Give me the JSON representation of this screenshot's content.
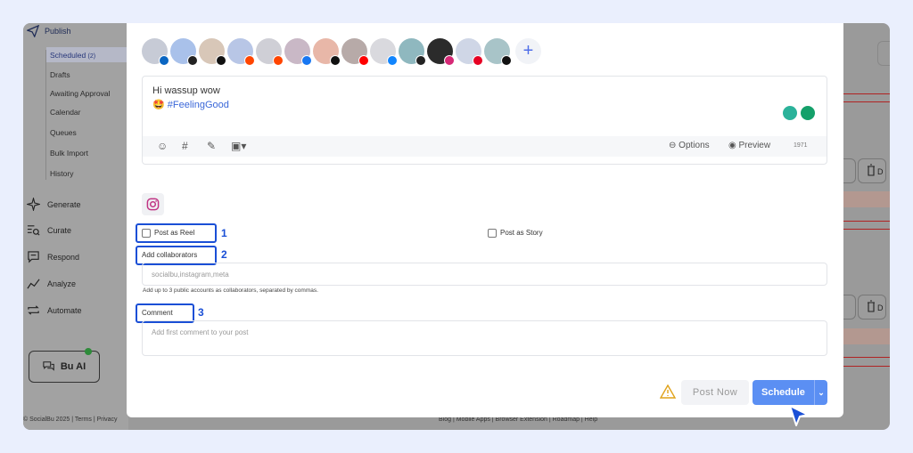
{
  "sidebar": {
    "publish": "Publish",
    "sub_items": [
      {
        "label": "Scheduled",
        "count": "(2)"
      },
      {
        "label": "Drafts"
      },
      {
        "label": "Awaiting Approval"
      },
      {
        "label": "Calendar"
      },
      {
        "label": "Queues"
      },
      {
        "label": "Bulk Import"
      },
      {
        "label": "History"
      }
    ],
    "nav": [
      "Generate",
      "Curate",
      "Respond",
      "Analyze",
      "Automate"
    ],
    "ai_button": "Bu AI",
    "footer": "© SocialBu 2025 | Terms | Privacy"
  },
  "page_footer": "Blog | Mobile Apps | Browser Extension | Roadmap | Help",
  "composer": {
    "accounts": [
      {
        "badge": "linkedin",
        "color": "#0a66c2"
      },
      {
        "badge": "threads",
        "color": "#222"
      },
      {
        "badge": "x",
        "color": "#111"
      },
      {
        "badge": "reddit",
        "color": "#ff4500"
      },
      {
        "badge": "reddit",
        "color": "#ff4500"
      },
      {
        "badge": "facebook",
        "color": "#1877f2"
      },
      {
        "badge": "tiktok",
        "color": "#111"
      },
      {
        "badge": "youtube",
        "color": "#ff0000"
      },
      {
        "badge": "bluesky",
        "color": "#1185fe"
      },
      {
        "badge": "threads",
        "color": "#222"
      },
      {
        "badge": "instagram",
        "color": "#d62976"
      },
      {
        "badge": "pinterest",
        "color": "#e60023"
      },
      {
        "badge": "x",
        "color": "#111"
      }
    ],
    "text_line1": "Hi wassup wow",
    "text_line2": "#FeelingGood",
    "options_label": "Options",
    "preview_label": "Preview",
    "char_count": "1971"
  },
  "instagram": {
    "post_as_reel": "Post as Reel",
    "post_as_story": "Post as Story",
    "add_collaborators": "Add collaborators",
    "collaborators_placeholder": "socialbu,instagram,meta",
    "collaborators_hint": "Add up to 3 public accounts as collaborators, separated by commas.",
    "comment_label": "Comment",
    "comment_placeholder": "Add first comment to your post",
    "annotations": [
      "1",
      "2",
      "3"
    ]
  },
  "actions": {
    "post_now": "Post Now",
    "schedule": "Schedule"
  },
  "colors": {
    "accent": "#5b8ff3",
    "annotation": "#1a4fd6",
    "hashtag": "#3a67d8"
  }
}
